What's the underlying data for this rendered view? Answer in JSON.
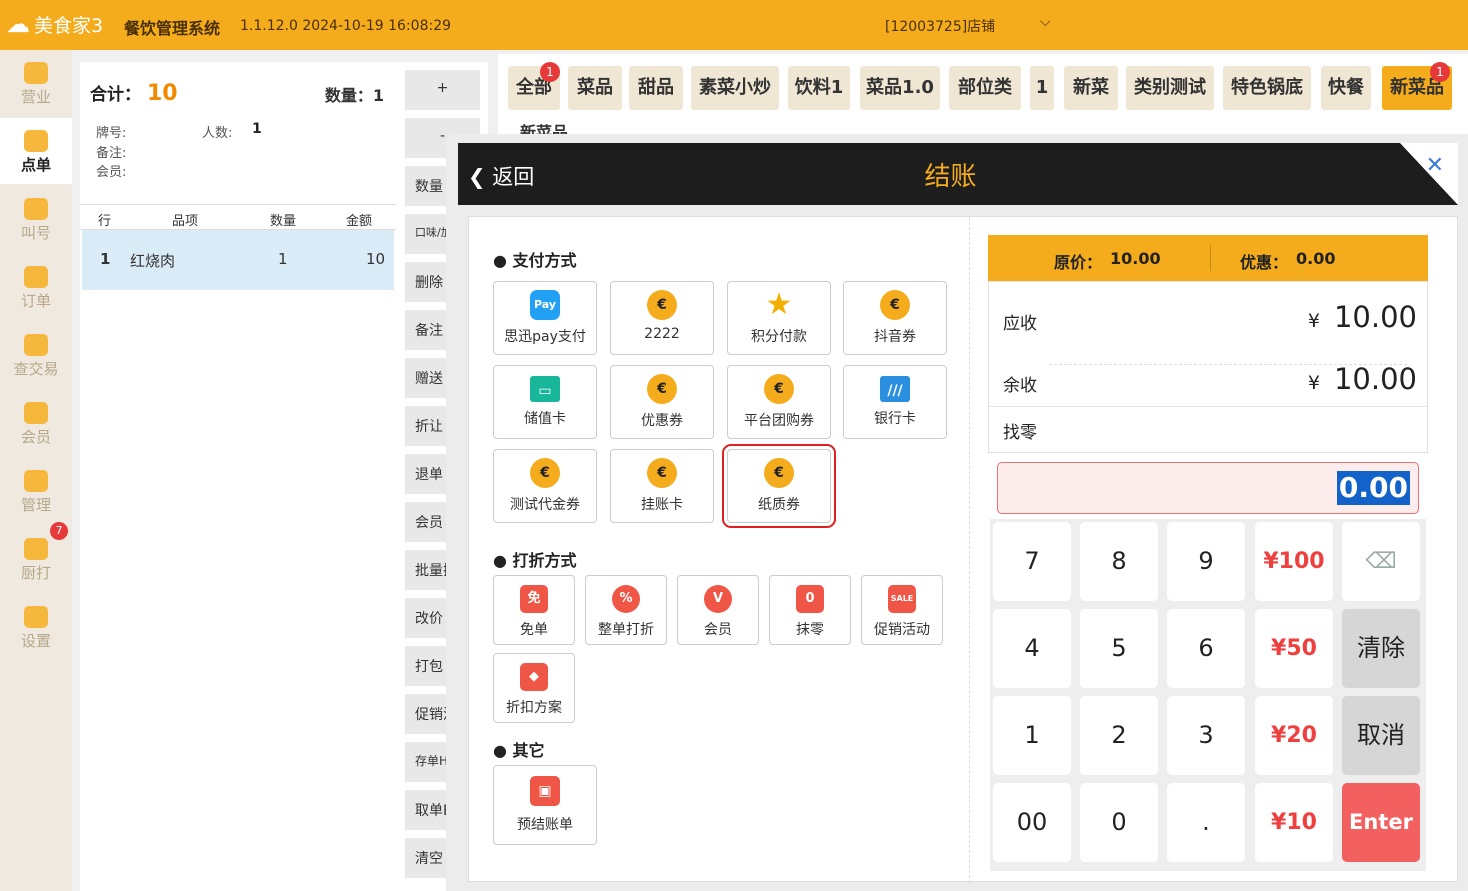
{
  "topbar": {
    "logo": "美食家3",
    "system": "餐饮管理系统",
    "version": "1.1.12.0 2024-10-19 16:08:29",
    "store": "[12003725]店铺",
    "store_chevron": "⌵"
  },
  "sidebar": {
    "items": [
      {
        "label": "营业",
        "icon": "chart-icon"
      },
      {
        "label": "点单",
        "icon": "hand-pointer-icon",
        "active": true
      },
      {
        "label": "叫号",
        "icon": "number-icon"
      },
      {
        "label": "订单",
        "icon": "list-icon"
      },
      {
        "label": "查交易",
        "icon": "search-icon"
      },
      {
        "label": "会员",
        "icon": "diamond-icon"
      },
      {
        "label": "管理",
        "icon": "manage-icon"
      },
      {
        "label": "厨打",
        "icon": "printer-icon",
        "badge": "7"
      },
      {
        "label": "设置",
        "icon": "gear-icon"
      }
    ]
  },
  "order": {
    "total_label": "合计：",
    "total": "10",
    "qty_label": "数量：",
    "qty": "1",
    "plate_label": "牌号:",
    "people_label": "人数:",
    "people": "1",
    "note_label": "备注:",
    "member_label": "会员:",
    "headers": [
      "行",
      "品项",
      "数量",
      "金额"
    ],
    "rows": [
      {
        "no": "1",
        "item": "红烧肉",
        "qty": "1",
        "amount": "10"
      }
    ]
  },
  "action_buttons": [
    "+",
    "-",
    "数量",
    "口味/加",
    "删除",
    "备注",
    "赠送",
    "折让",
    "退单",
    "会员",
    "批量操",
    "改价",
    "打包",
    "促销活",
    "存单HO",
    "取单E",
    "清空"
  ],
  "categories": [
    {
      "label": "全部",
      "badge": "1"
    },
    {
      "label": "菜品"
    },
    {
      "label": "甜品"
    },
    {
      "label": "素菜小炒"
    },
    {
      "label": "饮料1"
    },
    {
      "label": "菜品1.0"
    },
    {
      "label": "部位类"
    },
    {
      "label": "1"
    },
    {
      "label": "新菜"
    },
    {
      "label": "类别测试"
    },
    {
      "label": "特色锅底"
    },
    {
      "label": "快餐"
    },
    {
      "label": "新菜品",
      "badge": "1",
      "active": true
    },
    {
      "label": "新菜品"
    }
  ],
  "checkout": {
    "back": "返回",
    "title": "结账",
    "close": "✕",
    "pay_section": "支付方式",
    "pay_methods": [
      {
        "label": "思迅pay支付",
        "icon": "pay-icon",
        "glyph": "Pay"
      },
      {
        "label": "2222",
        "icon": "coin-icon",
        "glyph": "€"
      },
      {
        "label": "积分付款",
        "icon": "star-icon",
        "glyph": "★"
      },
      {
        "label": "抖音券",
        "icon": "coin-icon",
        "glyph": "€"
      },
      {
        "label": "储值卡",
        "icon": "card-icon",
        "glyph": "▭"
      },
      {
        "label": "优惠券",
        "icon": "coin-icon",
        "glyph": "€"
      },
      {
        "label": "平台团购券",
        "icon": "coin-icon",
        "glyph": "€"
      },
      {
        "label": "银行卡",
        "icon": "bank-card-icon",
        "glyph": "///"
      },
      {
        "label": "测试代金券",
        "icon": "coin-icon",
        "glyph": "€"
      },
      {
        "label": "挂账卡",
        "icon": "coin-icon",
        "glyph": "€"
      },
      {
        "label": "纸质券",
        "icon": "coin-icon",
        "glyph": "€",
        "selected": true
      }
    ],
    "discount_section": "打折方式",
    "discounts": [
      {
        "label": "免单",
        "icon": "free-icon",
        "glyph": "免"
      },
      {
        "label": "整单打折",
        "icon": "percent-icon",
        "glyph": "%"
      },
      {
        "label": "会员",
        "icon": "member-icon",
        "glyph": "V"
      },
      {
        "label": "抹零",
        "icon": "round-off-icon",
        "glyph": "0"
      },
      {
        "label": "促销活动",
        "icon": "sale-icon",
        "glyph": "SALE"
      },
      {
        "label": "折扣方案",
        "icon": "tag-icon",
        "glyph": "◆"
      }
    ],
    "other_section": "其它",
    "others": [
      {
        "label": "预结账单",
        "icon": "wallet-icon",
        "glyph": "▣"
      }
    ],
    "original_label": "原价：",
    "original": "10.00",
    "discount_label": "优惠：",
    "discount": "0.00",
    "receivable_label": "应收",
    "receivable": "10.00",
    "balance_label": "余收",
    "balance": "10.00",
    "change_label": "找零",
    "currency": "¥",
    "input": "0.00",
    "keypad": [
      "7",
      "8",
      "9",
      "¥100",
      "⌫",
      "4",
      "5",
      "6",
      "¥50",
      "清除",
      "1",
      "2",
      "3",
      "¥20",
      "取消",
      "00",
      "0",
      ".",
      "¥10",
      "Enter"
    ]
  }
}
